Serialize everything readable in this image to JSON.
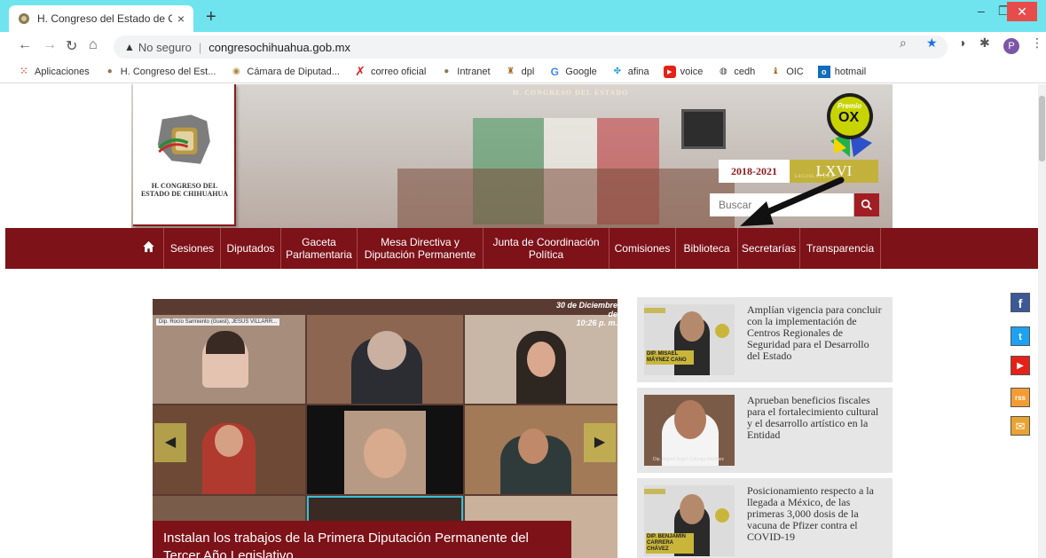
{
  "browser": {
    "tab_title": "H. Congreso del Estado de Chihu",
    "tab_close": "×",
    "new_tab": "+",
    "security_label": "No seguro",
    "url": "congresochihuahua.gob.mx",
    "profile_initial": "P",
    "window_minimize": "–",
    "window_maximize": "❐",
    "window_close": "✕"
  },
  "bookmarks": [
    {
      "label": "Aplicaciones",
      "icon": "apps-grid-icon"
    },
    {
      "label": "H. Congreso del Est...",
      "icon": "congress-icon"
    },
    {
      "label": "Cámara de Diputad...",
      "icon": "camara-icon"
    },
    {
      "label": "correo oficial",
      "icon": "x-icon"
    },
    {
      "label": "Intranet",
      "icon": "congress-icon"
    },
    {
      "label": "dpl",
      "icon": "dpl-icon"
    },
    {
      "label": "Google",
      "icon": "google-icon"
    },
    {
      "label": "afina",
      "icon": "afina-icon"
    },
    {
      "label": "voice",
      "icon": "youtube-icon"
    },
    {
      "label": "cedh",
      "icon": "globe-icon"
    },
    {
      "label": "OIC",
      "icon": "oic-icon"
    },
    {
      "label": "hotmail",
      "icon": "outlook-icon"
    }
  ],
  "header": {
    "banner_title": "H. CONGRESO DEL ESTADO",
    "logo_text": "H. CONGRESO DEL ESTADO DE CHIHUAHUA",
    "award_label": "Premio",
    "award_mark": "OX",
    "period": "2018-2021",
    "legislature": "LXVI",
    "legislature_sub": "LEGISLATURA",
    "search_placeholder": "Buscar"
  },
  "nav": {
    "items": [
      "Sesiones",
      "Diputados",
      "Gaceta Parlamentaria",
      "Mesa Directiva y Diputación Permanente",
      "Junta de Coordinación Política",
      "Comisiones",
      "Biblioteca",
      "Secretarías",
      "Transparencia"
    ]
  },
  "carousel": {
    "date": "30 de Diciembre de",
    "time": "10:26 p. m.",
    "ticker": "Dip. Rocío Sarmiento (Guest), JESUS VILLARR...",
    "caption": "Instalan los trabajos de la Primera Diputación Permanente del Tercer Año Legislativo",
    "prev": "◀",
    "next": "▶"
  },
  "news": [
    {
      "text": "Amplían vigencia para concluir con la implementación de Centros Regionales de Seguridad para el Desarrollo del Estado",
      "thumb_label": "DIP. MISAEL MÁYNEZ CANO"
    },
    {
      "text": "Aprueban beneficios fiscales para el fortalecimiento cultural y el desarrollo artístico en la Entidad",
      "thumb_label": "Dip. Miguel Ángel Colunga Martínez"
    },
    {
      "text": "Posicionamiento respecto a la llegada a México, de las primeras 3,000 dosis de la vacuna de Pfizer contra el COVID-19",
      "thumb_label": "DIP. BENJAMÍN CARRERA CHÁVEZ"
    }
  ],
  "social": [
    "f",
    "t",
    "▶",
    "rss",
    "✉"
  ]
}
